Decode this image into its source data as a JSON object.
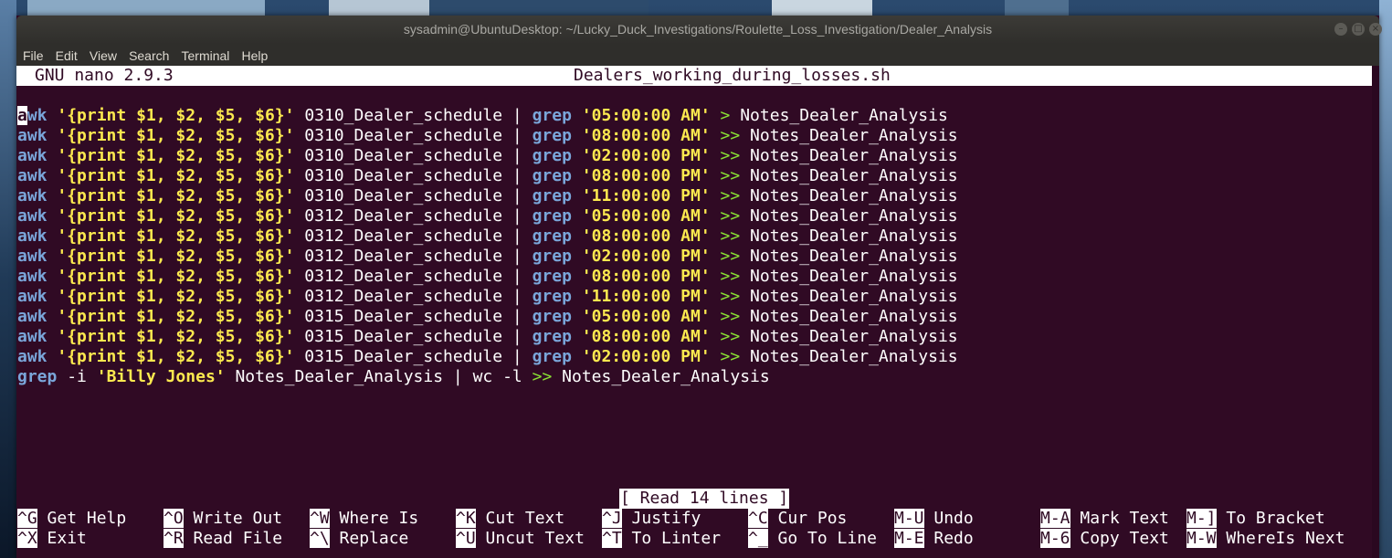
{
  "window": {
    "title": "sysadmin@UbuntuDesktop: ~/Lucky_Duck_Investigations/Roulette_Loss_Investigation/Dealer_Analysis",
    "buttons": [
      "–",
      "□",
      "×"
    ]
  },
  "menu": [
    "File",
    "Edit",
    "View",
    "Search",
    "Terminal",
    "Help"
  ],
  "nano": {
    "version": "GNU nano 2.9.3",
    "filename": "Dealers_working_during_losses.sh",
    "status": "[ Read 14 lines ]"
  },
  "lines": [
    {
      "cmd": "awk",
      "program": "'{print $1, $2, $5, $6}'",
      "file": "0310_Dealer_schedule",
      "pipe": "|",
      "grep": "grep",
      "pattern": "'05:00:00 AM'",
      "redir": ">",
      "target": "Notes_Dealer_Analysis"
    },
    {
      "cmd": "awk",
      "program": "'{print $1, $2, $5, $6}'",
      "file": "0310_Dealer_schedule",
      "pipe": "|",
      "grep": "grep",
      "pattern": "'08:00:00 AM'",
      "redir": ">>",
      "target": "Notes_Dealer_Analysis"
    },
    {
      "cmd": "awk",
      "program": "'{print $1, $2, $5, $6}'",
      "file": "0310_Dealer_schedule",
      "pipe": "|",
      "grep": "grep",
      "pattern": "'02:00:00 PM'",
      "redir": ">>",
      "target": "Notes_Dealer_Analysis"
    },
    {
      "cmd": "awk",
      "program": "'{print $1, $2, $5, $6}'",
      "file": "0310_Dealer_schedule",
      "pipe": "|",
      "grep": "grep",
      "pattern": "'08:00:00 PM'",
      "redir": ">>",
      "target": "Notes_Dealer_Analysis"
    },
    {
      "cmd": "awk",
      "program": "'{print $1, $2, $5, $6}'",
      "file": "0310_Dealer_schedule",
      "pipe": "|",
      "grep": "grep",
      "pattern": "'11:00:00 PM'",
      "redir": ">>",
      "target": "Notes_Dealer_Analysis"
    },
    {
      "cmd": "awk",
      "program": "'{print $1, $2, $5, $6}'",
      "file": "0312_Dealer_schedule",
      "pipe": "|",
      "grep": "grep",
      "pattern": "'05:00:00 AM'",
      "redir": ">>",
      "target": "Notes_Dealer_Analysis"
    },
    {
      "cmd": "awk",
      "program": "'{print $1, $2, $5, $6}'",
      "file": "0312_Dealer_schedule",
      "pipe": "|",
      "grep": "grep",
      "pattern": "'08:00:00 AM'",
      "redir": ">>",
      "target": "Notes_Dealer_Analysis"
    },
    {
      "cmd": "awk",
      "program": "'{print $1, $2, $5, $6}'",
      "file": "0312_Dealer_schedule",
      "pipe": "|",
      "grep": "grep",
      "pattern": "'02:00:00 PM'",
      "redir": ">>",
      "target": "Notes_Dealer_Analysis"
    },
    {
      "cmd": "awk",
      "program": "'{print $1, $2, $5, $6}'",
      "file": "0312_Dealer_schedule",
      "pipe": "|",
      "grep": "grep",
      "pattern": "'08:00:00 PM'",
      "redir": ">>",
      "target": "Notes_Dealer_Analysis"
    },
    {
      "cmd": "awk",
      "program": "'{print $1, $2, $5, $6}'",
      "file": "0312_Dealer_schedule",
      "pipe": "|",
      "grep": "grep",
      "pattern": "'11:00:00 PM'",
      "redir": ">>",
      "target": "Notes_Dealer_Analysis"
    },
    {
      "cmd": "awk",
      "program": "'{print $1, $2, $5, $6}'",
      "file": "0315_Dealer_schedule",
      "pipe": "|",
      "grep": "grep",
      "pattern": "'05:00:00 AM'",
      "redir": ">>",
      "target": "Notes_Dealer_Analysis"
    },
    {
      "cmd": "awk",
      "program": "'{print $1, $2, $5, $6}'",
      "file": "0315_Dealer_schedule",
      "pipe": "|",
      "grep": "grep",
      "pattern": "'08:00:00 AM'",
      "redir": ">>",
      "target": "Notes_Dealer_Analysis"
    },
    {
      "cmd": "awk",
      "program": "'{print $1, $2, $5, $6}'",
      "file": "0315_Dealer_schedule",
      "pipe": "|",
      "grep": "grep",
      "pattern": "'02:00:00 PM'",
      "redir": ">>",
      "target": "Notes_Dealer_Analysis"
    }
  ],
  "last_line": {
    "grep": "grep",
    "flag": "-i",
    "pattern": "'Billy Jones'",
    "file": "Notes_Dealer_Analysis",
    "pipe": "|",
    "wc": "wc -l",
    "redir": ">>",
    "target": "Notes_Dealer_Analysis"
  },
  "shortcuts": [
    {
      "key": "^G",
      "label": "Get Help"
    },
    {
      "key": "^O",
      "label": "Write Out"
    },
    {
      "key": "^W",
      "label": "Where Is"
    },
    {
      "key": "^K",
      "label": "Cut Text"
    },
    {
      "key": "^J",
      "label": "Justify"
    },
    {
      "key": "^C",
      "label": "Cur Pos"
    },
    {
      "key": "M-U",
      "label": "Undo"
    },
    {
      "key": "M-A",
      "label": "Mark Text"
    },
    {
      "key": "M-]",
      "label": "To Bracket"
    },
    {
      "key": "^X",
      "label": "Exit"
    },
    {
      "key": "^R",
      "label": "Read File"
    },
    {
      "key": "^\\",
      "label": "Replace"
    },
    {
      "key": "^U",
      "label": "Uncut Text"
    },
    {
      "key": "^T",
      "label": "To Linter"
    },
    {
      "key": "^_",
      "label": "Go To Line"
    },
    {
      "key": "M-E",
      "label": "Redo"
    },
    {
      "key": "M-6",
      "label": "Copy Text"
    },
    {
      "key": "M-W",
      "label": "WhereIs Next"
    }
  ],
  "colors": {
    "terminal_bg": "#300a24",
    "keyword": "#7aa6da",
    "string": "#fce94f",
    "operator": "#8ae234"
  }
}
